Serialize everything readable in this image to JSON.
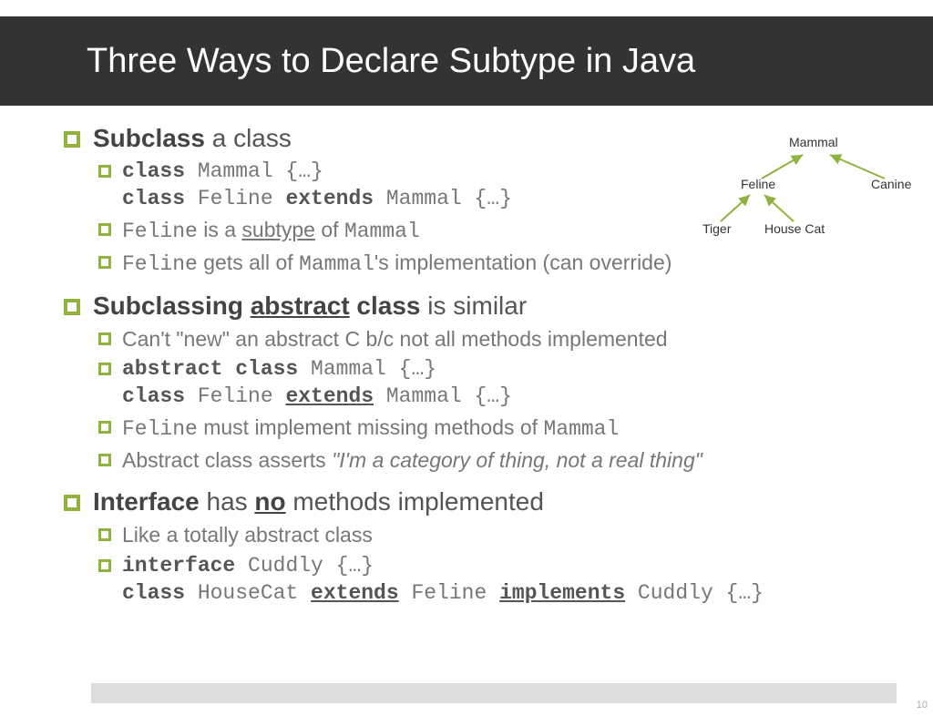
{
  "title": "Three Ways to Declare Subtype in Java",
  "page_number": "10",
  "tree": {
    "root": "Mammal",
    "left": "Feline",
    "right": "Canine",
    "leaf1": "Tiger",
    "leaf2": "House Cat"
  },
  "sections": {
    "s1": {
      "heading_bold": "Subclass",
      "heading_rest": " a class",
      "code_l1a": "class",
      "code_l1b": " Mammal {…}",
      "code_l2a": "class",
      "code_l2b": " Feline ",
      "code_l2c": "extends",
      "code_l2d": " Mammal {…}",
      "p2a": "Feline",
      "p2b": " is a ",
      "p2c": "subtype",
      "p2d": " of ",
      "p2e": "Mammal",
      "p3a": "Feline",
      "p3b": " gets all of ",
      "p3c": "Mammal",
      "p3d": "'s implementation (can override)"
    },
    "s2": {
      "heading_a": "Subclassing ",
      "heading_b": "abstract",
      "heading_c": " class",
      "heading_d": " is similar",
      "p1": "Can't \"new\" an abstract C b/c not all methods implemented",
      "code_l1a": "abstract class",
      "code_l1b": " Mammal {…}",
      "code_l2a": "class",
      "code_l2b": " Feline ",
      "code_l2c": "extends",
      "code_l2d": " Mammal {…}",
      "p3a": "Feline",
      "p3b": " must implement missing methods of ",
      "p3c": "Mammal",
      "p4a": "Abstract class asserts ",
      "p4b": "\"I'm a category of thing, not a real thing\""
    },
    "s3": {
      "heading_a": "Interface",
      "heading_b": " has ",
      "heading_c": "no",
      "heading_d": " methods implemented",
      "p1": "Like a totally abstract class",
      "code_l1a": "interface",
      "code_l1b": " Cuddly {…}",
      "code_l2a": "class",
      "code_l2b": " HouseCat ",
      "code_l2c": "extends",
      "code_l2d": " Feline ",
      "code_l2e": "implements",
      "code_l2f": " Cuddly {…}"
    }
  }
}
